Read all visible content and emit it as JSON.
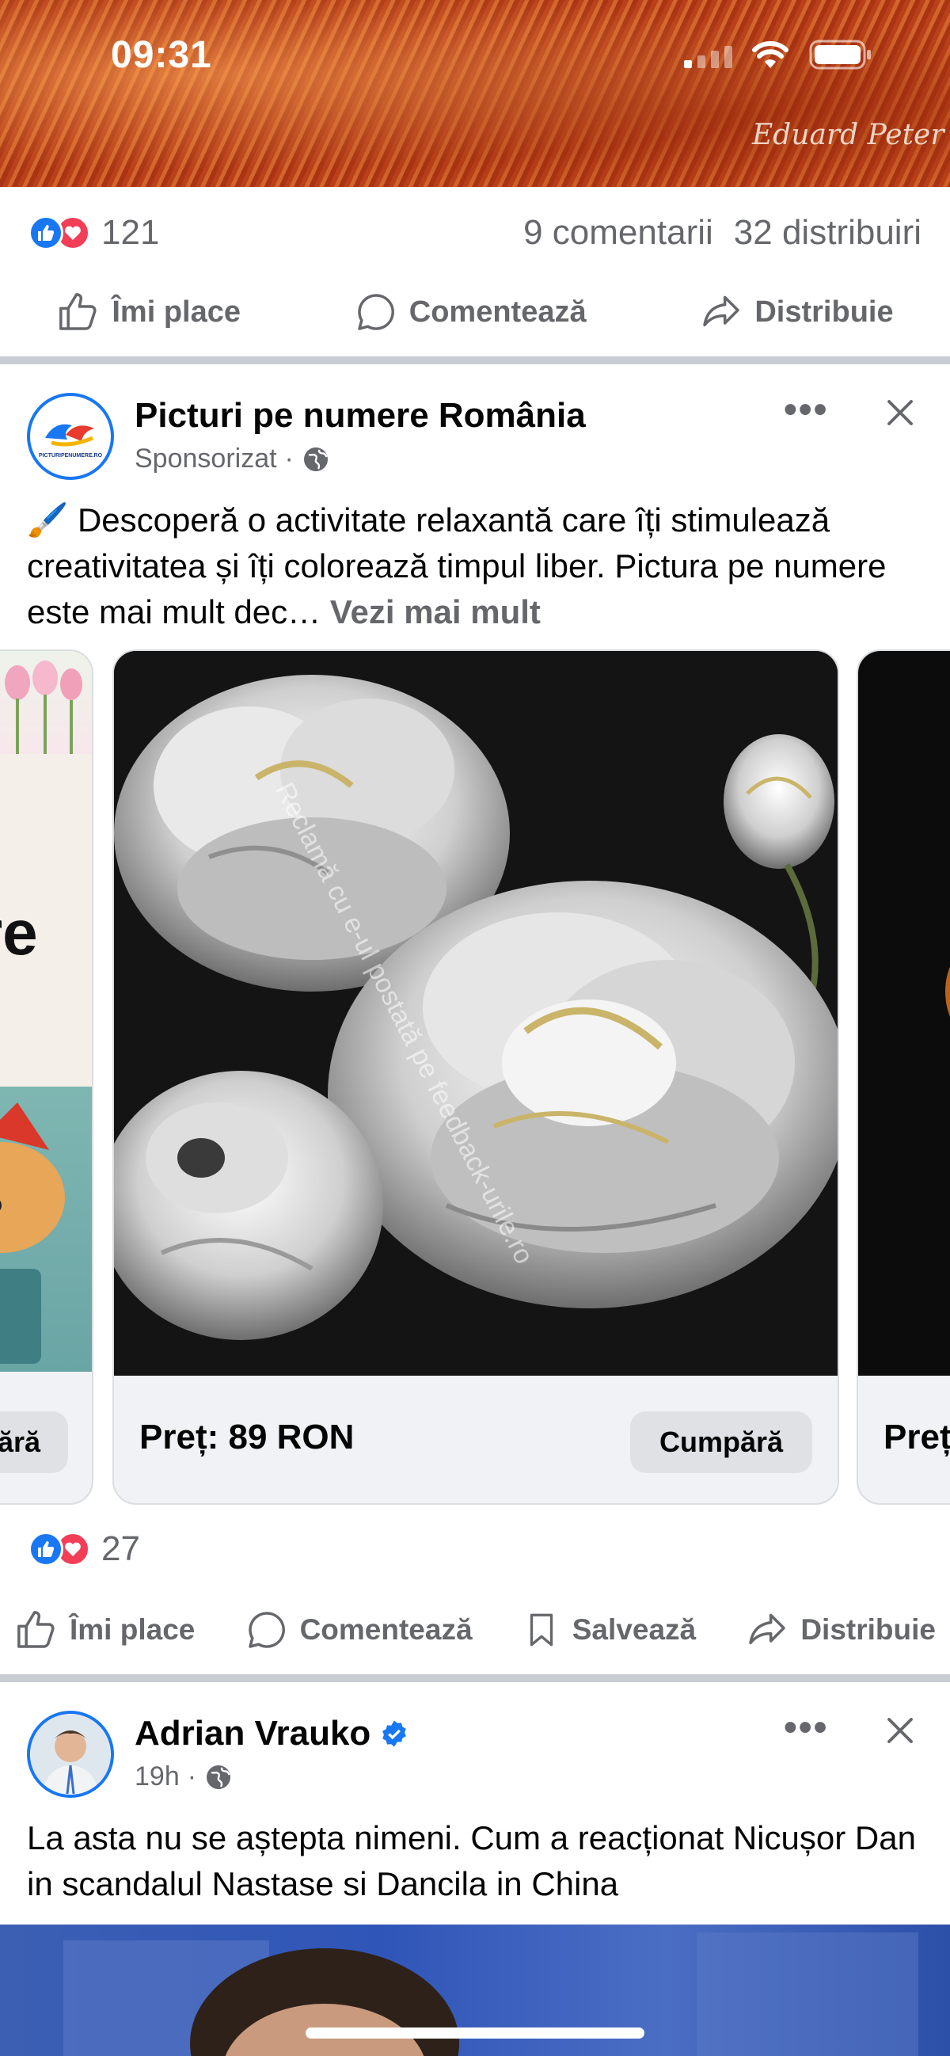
{
  "status_bar": {
    "time": "09:31"
  },
  "post1": {
    "photo_signature": "Eduard Peter",
    "reaction_count": "121",
    "comments": "9 comentarii",
    "shares": "32 distribuiri",
    "actions": {
      "like": "Îmi place",
      "comment": "Comentează",
      "share": "Distribuie"
    }
  },
  "post2": {
    "page_name": "Picturi pe numere România",
    "meta": "Sponsorizat",
    "avatar_text": "PICTURIPENUMERE.RO",
    "text_emoji": "🖌️",
    "text": "Descoperă o activitate relaxantă care îți stimulează creativitatea și îți colorează timpul liber. Pictura pe numere este mai mult dec…",
    "see_more": "Vezi mai mult",
    "watermark": "Reclamă cu e-ul postată pe feedback-urile.ro",
    "left_card": {
      "partial_text": "re",
      "button": "ără"
    },
    "main_card": {
      "price": "Preț: 89 RON",
      "button": "Cumpără"
    },
    "right_card": {
      "price": "Preț"
    },
    "reaction_count": "27",
    "actions": {
      "like": "Îmi place",
      "comment": "Comentează",
      "save": "Salvează",
      "share": "Distribuie"
    }
  },
  "post3": {
    "author": "Adrian Vrauko",
    "time": "19h",
    "text": "La asta nu se aștepta nimeni. Cum a reacționat Nicușor Dan in scandalul Nastase si Dancila in China"
  },
  "colors": {
    "accent": "#1877f2",
    "heart": "#f33e58",
    "divider": "#c9ccd1"
  }
}
